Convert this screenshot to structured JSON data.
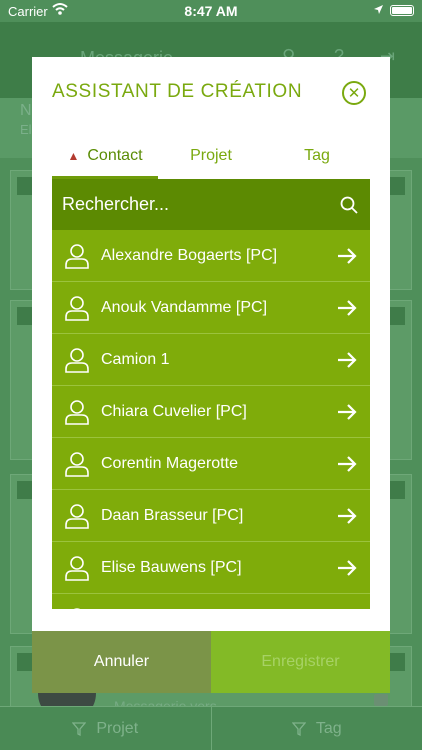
{
  "status": {
    "carrier": "Carrier",
    "time": "8:47 AM"
  },
  "background": {
    "title": "Messagerie",
    "project_label": "Projet",
    "tag_label": "Tag",
    "footer_text": "Messagerie vers"
  },
  "modal": {
    "title": "ASSISTANT DE CRÉATION",
    "tabs": [
      {
        "label": "Contact",
        "warning": true
      },
      {
        "label": "Projet"
      },
      {
        "label": "Tag"
      }
    ],
    "search": {
      "placeholder": "Rechercher..."
    },
    "contacts": [
      "Alexandre Bogaerts [PC]",
      "Anouk Vandamme [PC]",
      "Camion 1",
      "Chiara Cuvelier [PC]",
      "Corentin Magerotte",
      "Daan Brasseur [PC]",
      "Elise Bauwens [PC]",
      ""
    ],
    "buttons": {
      "cancel": "Annuler",
      "save": "Enregistrer"
    }
  },
  "colors": {
    "accent": "#7aa90f",
    "list_bg": "#7fac0a",
    "search_bg": "#5c8a02",
    "warning": "#b33b30"
  }
}
